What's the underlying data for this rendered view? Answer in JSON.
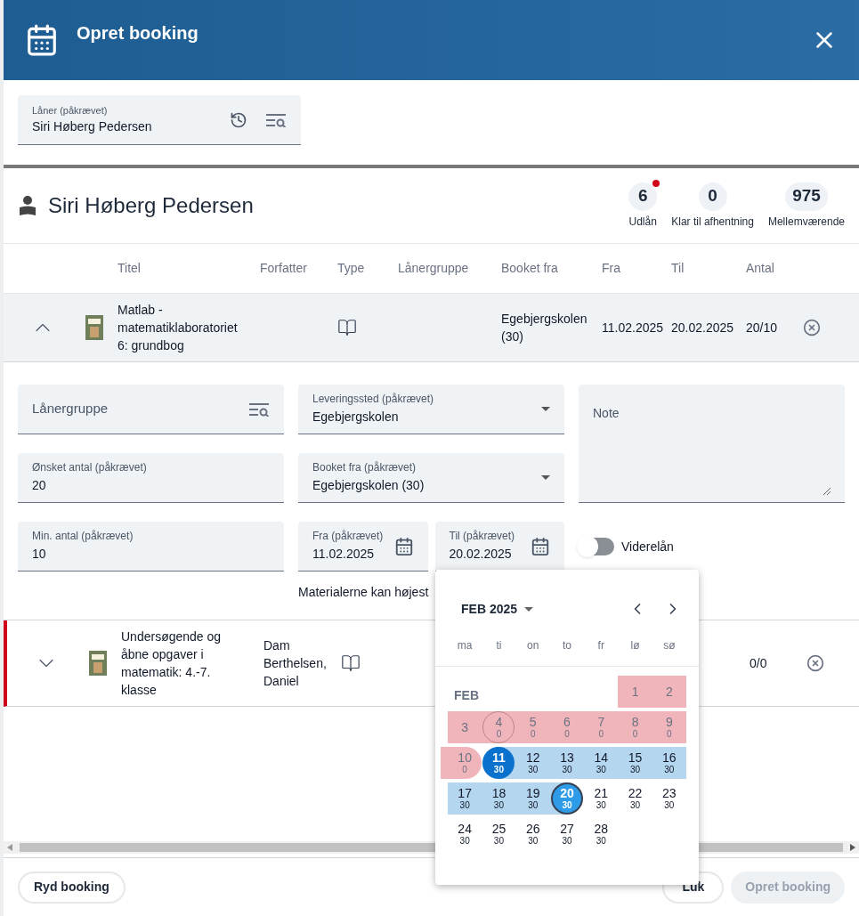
{
  "dialog": {
    "title": "Opret booking"
  },
  "loaner_field": {
    "label": "Låner (påkrævet)",
    "value": "Siri Høberg Pedersen"
  },
  "patron": {
    "name": "Siri Høberg Pedersen",
    "stats": [
      {
        "value": "6",
        "label": "Udlån",
        "alert": true
      },
      {
        "value": "0",
        "label": "Klar til afhentning",
        "alert": false
      },
      {
        "value": "975",
        "label": "Mellemværende",
        "alert": false
      }
    ]
  },
  "table": {
    "columns": [
      "Titel",
      "Forfatter",
      "Type",
      "Lånergruppe",
      "Booket fra",
      "Fra",
      "Til",
      "Antal"
    ],
    "rows": [
      {
        "expanded": true,
        "flagged": false,
        "title": "Matlab - matematiklaboratoriet 6: grundbog",
        "author": "",
        "booked_from": "Egebjergskolen (30)",
        "from": "11.02.2025",
        "to": "20.02.2025",
        "count": "20/10"
      },
      {
        "expanded": false,
        "flagged": true,
        "title": "Undersøgende og åbne opgaver i matematik: 4.-7. klasse",
        "author": "Dam Berthelsen, Daniel",
        "booked_from": "",
        "from": "",
        "to": "",
        "count": "0/0"
      }
    ]
  },
  "form": {
    "loaner_group": {
      "placeholder": "Lånergruppe"
    },
    "delivery": {
      "label": "Leveringssted (påkrævet)",
      "value": "Egebjergskolen"
    },
    "note": {
      "placeholder": "Note"
    },
    "wanted": {
      "label": "Ønsket antal (påkrævet)",
      "value": "20"
    },
    "booked_from": {
      "label": "Booket fra (påkrævet)",
      "value": "Egebjergskolen (30)"
    },
    "min": {
      "label": "Min. antal (påkrævet)",
      "value": "10"
    },
    "from": {
      "label": "Fra (påkrævet)",
      "value": "11.02.2025"
    },
    "to": {
      "label": "Til (påkrævet)",
      "value": "20.02.2025"
    },
    "relend": {
      "label": "Viderelån",
      "on": false
    },
    "message": "Materialerne kan højest"
  },
  "calendar": {
    "month_year": "FEB 2025",
    "month_label": "FEB",
    "weekdays": [
      "ma",
      "ti",
      "on",
      "to",
      "fr",
      "lø",
      "sø"
    ],
    "weeks": [
      [
        {
          "kind": "empty"
        },
        {
          "kind": "empty"
        },
        {
          "kind": "empty"
        },
        {
          "kind": "empty"
        },
        {
          "kind": "empty"
        },
        {
          "kind": "blocked",
          "day": "1"
        },
        {
          "kind": "blocked",
          "day": "2"
        }
      ],
      [
        {
          "kind": "blocked",
          "day": "3"
        },
        {
          "kind": "blocked-today",
          "day": "4",
          "count": "0"
        },
        {
          "kind": "blocked",
          "day": "5",
          "count": "0"
        },
        {
          "kind": "blocked",
          "day": "6",
          "count": "0"
        },
        {
          "kind": "blocked",
          "day": "7",
          "count": "0"
        },
        {
          "kind": "blocked",
          "day": "8",
          "count": "0"
        },
        {
          "kind": "blocked",
          "day": "9",
          "count": "0"
        }
      ],
      [
        {
          "kind": "blocked-end",
          "day": "10",
          "count": "0"
        },
        {
          "kind": "start",
          "day": "11",
          "count": "30"
        },
        {
          "kind": "range",
          "day": "12",
          "count": "30"
        },
        {
          "kind": "range",
          "day": "13",
          "count": "30"
        },
        {
          "kind": "range",
          "day": "14",
          "count": "30"
        },
        {
          "kind": "range",
          "day": "15",
          "count": "30"
        },
        {
          "kind": "range",
          "day": "16",
          "count": "30"
        }
      ],
      [
        {
          "kind": "range",
          "day": "17",
          "count": "30"
        },
        {
          "kind": "range",
          "day": "18",
          "count": "30"
        },
        {
          "kind": "range",
          "day": "19",
          "count": "30"
        },
        {
          "kind": "end",
          "day": "20",
          "count": "30"
        },
        {
          "kind": "free",
          "day": "21",
          "count": "30"
        },
        {
          "kind": "free",
          "day": "22",
          "count": "30"
        },
        {
          "kind": "free",
          "day": "23",
          "count": "30"
        }
      ],
      [
        {
          "kind": "free",
          "day": "24",
          "count": "30"
        },
        {
          "kind": "free",
          "day": "25",
          "count": "30"
        },
        {
          "kind": "free",
          "day": "26",
          "count": "30"
        },
        {
          "kind": "free",
          "day": "27",
          "count": "30"
        },
        {
          "kind": "free",
          "day": "28",
          "count": "30"
        },
        {
          "kind": "empty"
        },
        {
          "kind": "empty"
        }
      ]
    ]
  },
  "footer": {
    "clear": "Ryd booking",
    "close": "Luk",
    "create": {
      "label": "Opret booking",
      "disabled": true
    }
  }
}
